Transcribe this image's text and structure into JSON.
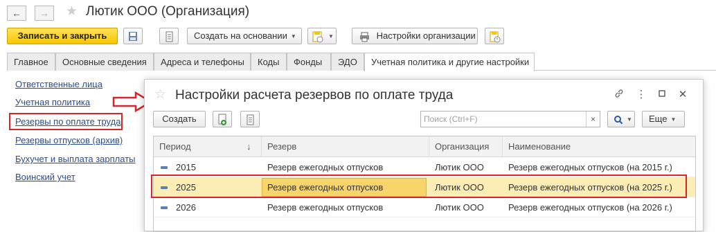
{
  "window": {
    "title": "Лютик ООО (Организация)"
  },
  "toolbar": {
    "save_close": "Записать и закрыть",
    "create_based": "Создать на основании",
    "org_settings": "Настройки организации"
  },
  "tabs": [
    {
      "label": "Главное"
    },
    {
      "label": "Основные сведения"
    },
    {
      "label": "Адреса и телефоны"
    },
    {
      "label": "Коды"
    },
    {
      "label": "Фонды"
    },
    {
      "label": "ЭДО"
    },
    {
      "label": "Учетная политика и другие настройки"
    }
  ],
  "sidebar": {
    "links": [
      {
        "label": "Ответственные лица"
      },
      {
        "label": "Учетная политика"
      },
      {
        "label": "Резервы по оплате труда"
      },
      {
        "label": "Резервы отпусков (архив)"
      },
      {
        "label": "Бухучет и выплата зарплаты"
      },
      {
        "label": "Воинский учет"
      }
    ]
  },
  "dialog": {
    "title": "Настройки расчета резервов по оплате труда",
    "create": "Создать",
    "search_placeholder": "Поиск (Ctrl+F)",
    "more": "Еще",
    "columns": [
      "Период",
      "Резерв",
      "Организация",
      "Наименование"
    ],
    "sort_indicator": "↓",
    "rows": [
      {
        "period": "2015",
        "reserve": "Резерв ежегодных отпусков",
        "org": "Лютик ООО",
        "name": "Резерв ежегодных отпусков (на 2015 г.)"
      },
      {
        "period": "2025",
        "reserve": "Резерв ежегодных отпусков",
        "org": "Лютик ООО",
        "name": "Резерв ежегодных отпусков (на 2025 г.)"
      },
      {
        "period": "2026",
        "reserve": "Резерв ежегодных отпусков",
        "org": "Лютик ООО",
        "name": "Резерв ежегодных отпусков (на 2026 г.)"
      }
    ]
  },
  "colors": {
    "accent": "#f6c700",
    "highlight": "#d8252b",
    "selection": "#fbedb4",
    "link": "#2b4c8c"
  }
}
